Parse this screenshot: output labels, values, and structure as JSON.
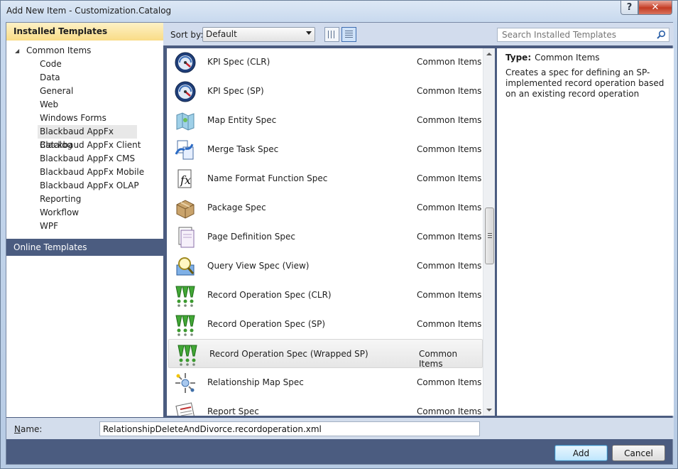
{
  "window": {
    "title": "Add New Item - Customization.Catalog",
    "help_label": "?",
    "close_label": "✕"
  },
  "left": {
    "installed_header": "Installed Templates",
    "root_label": "Common Items",
    "items": [
      "Code",
      "Data",
      "General",
      "Web",
      "Windows Forms",
      "Blackbaud AppFx Catalog",
      "Blackbaud AppFx Client",
      "Blackbaud AppFx CMS",
      "Blackbaud AppFx Mobile",
      "Blackbaud AppFx OLAP",
      "Reporting",
      "Workflow",
      "WPF"
    ],
    "selected_index": 5,
    "online_header": "Online Templates"
  },
  "toolbar": {
    "sort_label": "Sort by:",
    "sort_value": "Default"
  },
  "search": {
    "placeholder": "Search Installed Templates"
  },
  "list": {
    "rows": [
      {
        "name": "KPI Spec (CLR)",
        "category": "Common Items",
        "icon": "gauge-icon"
      },
      {
        "name": "KPI Spec (SP)",
        "category": "Common Items",
        "icon": "gauge-icon"
      },
      {
        "name": "Map Entity Spec",
        "category": "Common Items",
        "icon": "map-icon"
      },
      {
        "name": "Merge Task Spec",
        "category": "Common Items",
        "icon": "merge-icon"
      },
      {
        "name": "Name Format Function Spec",
        "category": "Common Items",
        "icon": "function-icon"
      },
      {
        "name": "Package Spec",
        "category": "Common Items",
        "icon": "package-icon"
      },
      {
        "name": "Page Definition Spec",
        "category": "Common Items",
        "icon": "page-icon"
      },
      {
        "name": "Query View Spec (View)",
        "category": "Common Items",
        "icon": "magnifier-icon"
      },
      {
        "name": "Record Operation Spec (CLR)",
        "category": "Common Items",
        "icon": "record-operation-icon"
      },
      {
        "name": "Record Operation Spec (SP)",
        "category": "Common Items",
        "icon": "record-operation-icon"
      },
      {
        "name": "Record Operation Spec (Wrapped SP)",
        "category": "Common Items",
        "icon": "record-operation-icon"
      },
      {
        "name": "Relationship Map Spec",
        "category": "Common Items",
        "icon": "relationship-icon"
      },
      {
        "name": "Report Spec",
        "category": "Common Items",
        "icon": "report-icon"
      }
    ],
    "selected_index": 10
  },
  "details": {
    "type_label": "Type:",
    "type_value": "Common Items",
    "description": "Creates a spec for defining an SP-implemented record operation based on an existing record operation"
  },
  "name_field": {
    "label": "Name:",
    "value": "RelationshipDeleteAndDivorce.recordoperation.xml"
  },
  "buttons": {
    "add": "Add",
    "cancel": "Cancel"
  }
}
